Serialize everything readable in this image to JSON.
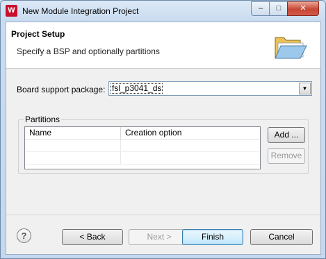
{
  "window": {
    "title": "New Module Integration Project",
    "app_icon": "W",
    "controls": {
      "minimize": "‒",
      "maximize": "□",
      "close": "✕"
    }
  },
  "header": {
    "title": "Project Setup",
    "description": "Specify a BSP and optionally partitions",
    "icon": "open-folder-icon"
  },
  "bsp": {
    "label": "Board support package:",
    "value": "fsl_p3041_ds"
  },
  "partitions": {
    "legend": "Partitions",
    "columns": [
      "Name",
      "Creation option"
    ],
    "rows": [],
    "add_label": "Add ...",
    "remove_label": "Remove"
  },
  "footer": {
    "help": "?",
    "back_label": "< Back",
    "next_label": "Next >",
    "finish_label": "Finish",
    "cancel_label": "Cancel"
  },
  "colors": {
    "title_bar": "#c9dcf0",
    "close_button": "#c74734",
    "app_icon": "#c8102e",
    "default_button_border": "#3c7fb1"
  }
}
